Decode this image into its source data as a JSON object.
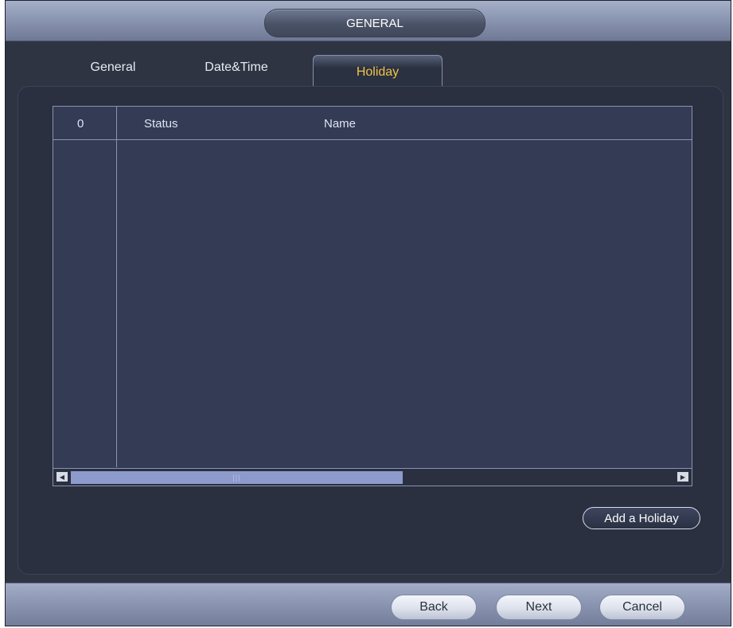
{
  "window": {
    "title": "GENERAL"
  },
  "tabs": [
    {
      "label": "General",
      "active": false
    },
    {
      "label": "Date&Time",
      "active": false
    },
    {
      "label": "Holiday",
      "active": true
    }
  ],
  "table": {
    "columns": [
      "0",
      "Status",
      "Name"
    ],
    "rows": []
  },
  "scrollbar": {
    "left_icon": "scroll-left-icon",
    "right_icon": "scroll-right-icon",
    "position": 0.0,
    "visible_fraction": 0.55
  },
  "add_holiday_label": "Add a Holiday",
  "footer": {
    "back_label": "Back",
    "next_label": "Next",
    "cancel_label": "Cancel"
  },
  "colors": {
    "active_tab_text": "#f0c24a",
    "panel_bg": "#2a3040",
    "table_bg": "#333b55",
    "scroll_thumb": "#8d9bcc"
  }
}
